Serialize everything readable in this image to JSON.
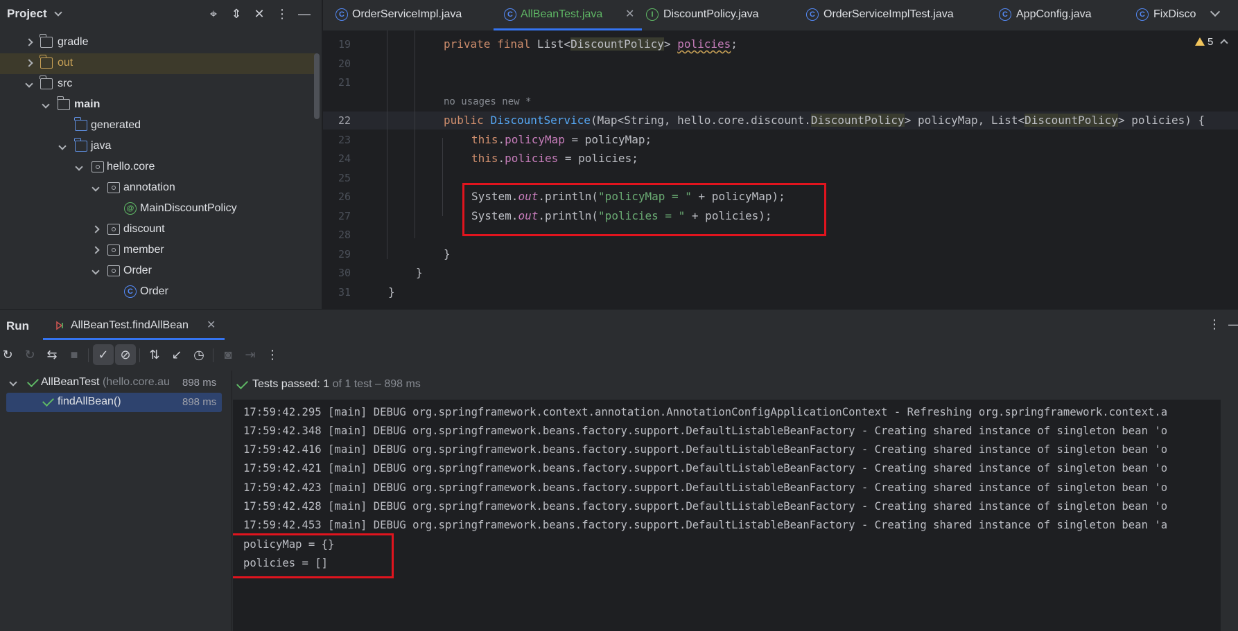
{
  "project": {
    "title": "Project",
    "tree": [
      {
        "label": "gradle",
        "kind": "folder"
      },
      {
        "label": "out",
        "kind": "folder-excluded"
      },
      {
        "label": "src",
        "kind": "folder"
      },
      {
        "label": "main",
        "kind": "source-root"
      },
      {
        "label": "generated",
        "kind": "generated-folder"
      },
      {
        "label": "java",
        "kind": "source-folder"
      },
      {
        "label": "hello.core",
        "kind": "package"
      },
      {
        "label": "annotation",
        "kind": "package"
      },
      {
        "label": "MainDiscountPolicy",
        "kind": "annotation"
      },
      {
        "label": "discount",
        "kind": "package"
      },
      {
        "label": "member",
        "kind": "package"
      },
      {
        "label": "Order",
        "kind": "package"
      },
      {
        "label": "Order",
        "kind": "class"
      }
    ]
  },
  "editor": {
    "tabs": [
      {
        "label": "OrderServiceImpl.java",
        "icon": "C"
      },
      {
        "label": "AllBeanTest.java",
        "icon": "C",
        "active": true
      },
      {
        "label": "DiscountPolicy.java",
        "icon": "I"
      },
      {
        "label": "OrderServiceImplTest.java",
        "icon": "C"
      },
      {
        "label": "AppConfig.java",
        "icon": "C"
      },
      {
        "label": "FixDisco",
        "icon": "C"
      }
    ],
    "close_glyph": "✕",
    "warning_count": "5",
    "inlay_hint": "no usages   new *",
    "line_numbers": [
      "19",
      "20",
      "21",
      "22",
      "23",
      "24",
      "25",
      "26",
      "27",
      "28",
      "29",
      "30",
      "31"
    ],
    "code": {
      "l19_private": "private",
      "l19_final": "final",
      "l19_list": "List<",
      "l19_type": "DiscountPolicy",
      "l19_close": ">",
      "l19_field": "policies",
      "l19_semi": ";",
      "l22_public": "public",
      "l22_ctor": "DiscountService",
      "l22_a": "(Map<String, hello.core.discount.",
      "l22_type1": "DiscountPolicy",
      "l22_b": "> policyMap, List<",
      "l22_type2": "DiscountPolicy",
      "l22_c": "> policies) {",
      "l23_this": "this",
      "l23_dot": ".",
      "l23_field": "policyMap",
      "l23_rest": " = policyMap;",
      "l24_this": "this",
      "l24_dot": ".",
      "l24_field": "policies",
      "l24_rest": " = policies;",
      "l26_sys": "System.",
      "l26_out": "out",
      "l26_a": ".println(",
      "l26_str": "\"policyMap = \"",
      "l26_b": " + policyMap);",
      "l27_sys": "System.",
      "l27_out": "out",
      "l27_a": ".println(",
      "l27_str": "\"policies = \"",
      "l27_b": " + policies);",
      "l29": "}",
      "l30": "}",
      "l31": "}"
    }
  },
  "run": {
    "title": "Run",
    "tab_label": "AllBeanTest.findAllBean",
    "close_glyph": "✕",
    "status_bold": "Tests passed: 1",
    "status_rest": " of 1 test – 898 ms",
    "tests": [
      {
        "name": "AllBeanTest",
        "pkg": " (hello.core.au",
        "time": "898 ms"
      },
      {
        "name": "findAllBean()",
        "time": "898 ms"
      }
    ],
    "log": [
      "17:59:42.295 [main] DEBUG org.springframework.context.annotation.AnnotationConfigApplicationContext - Refreshing org.springframework.context.a",
      "17:59:42.348 [main] DEBUG org.springframework.beans.factory.support.DefaultListableBeanFactory - Creating shared instance of singleton bean 'o",
      "17:59:42.416 [main] DEBUG org.springframework.beans.factory.support.DefaultListableBeanFactory - Creating shared instance of singleton bean 'o",
      "17:59:42.421 [main] DEBUG org.springframework.beans.factory.support.DefaultListableBeanFactory - Creating shared instance of singleton bean 'o",
      "17:59:42.423 [main] DEBUG org.springframework.beans.factory.support.DefaultListableBeanFactory - Creating shared instance of singleton bean 'o",
      "17:59:42.428 [main] DEBUG org.springframework.beans.factory.support.DefaultListableBeanFactory - Creating shared instance of singleton bean 'o",
      "17:59:42.453 [main] DEBUG org.springframework.beans.factory.support.DefaultListableBeanFactory - Creating shared instance of singleton bean 'a",
      "policyMap = {}",
      "policies = []"
    ]
  },
  "colors": {
    "accent": "#3574f0",
    "highlight_box": "#e0141e",
    "passed": "#5fb865"
  }
}
